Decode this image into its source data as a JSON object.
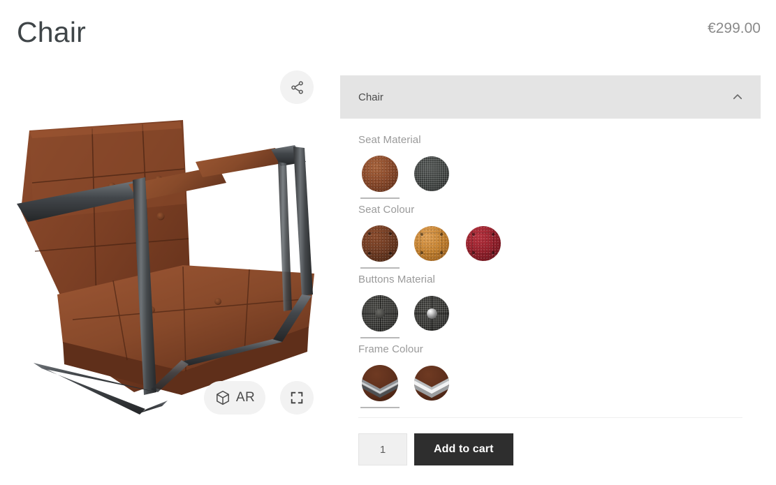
{
  "header": {
    "title": "Chair",
    "price": "€299.00"
  },
  "viewer": {
    "share_icon": "share-icon",
    "fullscreen_icon": "fullscreen-icon",
    "ar_icon": "cube-icon",
    "ar_label": "AR",
    "model_alt": "Brown tufted leather armchair with dark steel cantilever frame"
  },
  "config": {
    "accordion": {
      "title": "Chair",
      "chevron_icon": "chevron-up-icon",
      "expanded": true
    },
    "groups": [
      {
        "label": "Seat Material",
        "options": [
          {
            "name": "brown-leather",
            "selected": true,
            "color": "#8a4a2b"
          },
          {
            "name": "grey-fabric",
            "selected": false,
            "color": "#464a48"
          }
        ]
      },
      {
        "label": "Seat Colour",
        "options": [
          {
            "name": "dark-brown",
            "selected": true,
            "color": "#6d3a22"
          },
          {
            "name": "caramel",
            "selected": false,
            "color": "#c2802f"
          },
          {
            "name": "dark-red",
            "selected": false,
            "color": "#93202b"
          }
        ]
      },
      {
        "label": "Buttons Material",
        "options": [
          {
            "name": "matte-fabric",
            "selected": true,
            "color": "#3b3b38"
          },
          {
            "name": "chrome-metal",
            "selected": false,
            "color": "#3b3b38"
          }
        ]
      },
      {
        "label": "Frame Colour",
        "options": [
          {
            "name": "dark-steel",
            "selected": true,
            "color": "#5d2f1c"
          },
          {
            "name": "chrome",
            "selected": false,
            "color": "#5d2f1c"
          }
        ]
      }
    ],
    "purchase": {
      "quantity_value": "1",
      "quantity_placeholder": "1",
      "add_to_cart_label": "Add to cart"
    }
  },
  "colors": {
    "accordion_bg": "#e4e4e4",
    "label_text": "#9a9a9a",
    "title_text": "#3f4548",
    "price_text": "#8a8a8a",
    "cart_button_bg": "#2e2e2e",
    "qty_bg": "#f0f0f0"
  }
}
